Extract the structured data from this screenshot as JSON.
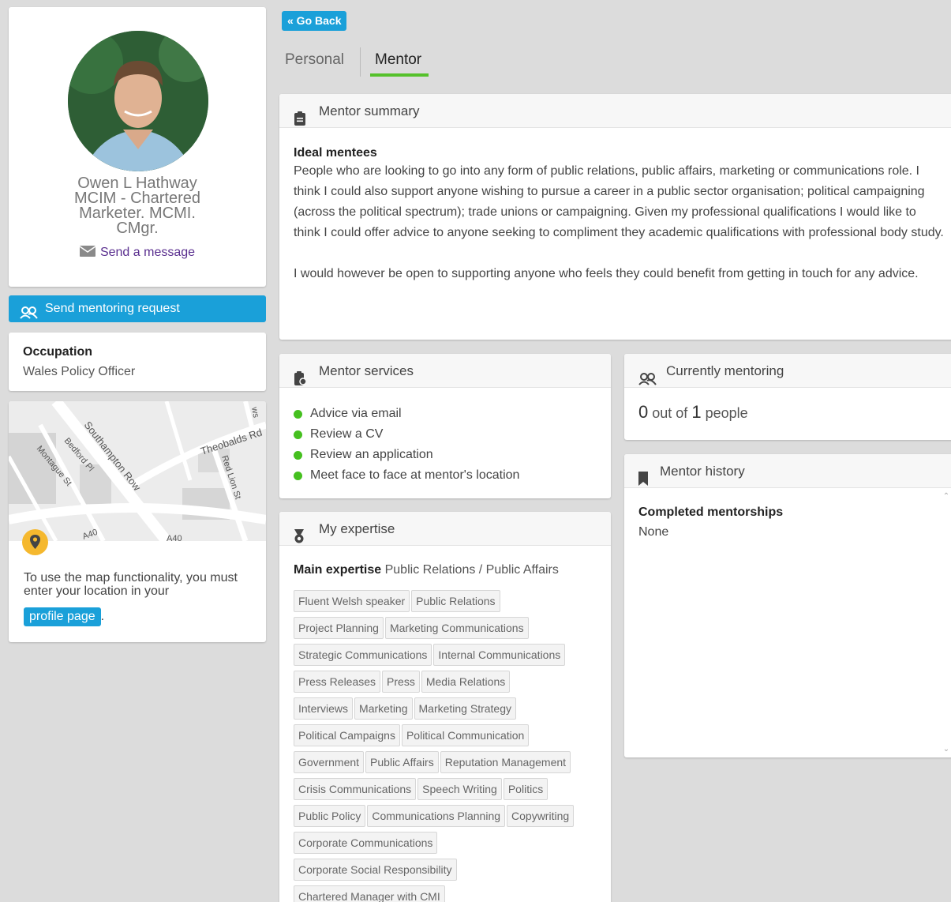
{
  "profile": {
    "name_line1": "Owen L Hathway",
    "name_line2": "MCIM - Chartered",
    "name_line3": "Marketer. MCMI.",
    "name_line4": "CMgr.",
    "send_message_label": "Send a message"
  },
  "mentoring_request_label": "Send mentoring request",
  "occupation": {
    "label": "Occupation",
    "value": "Wales Policy Officer"
  },
  "map": {
    "street_labels": [
      "Southampton Row",
      "Theobalds Rd",
      "Bedford Pl",
      "Montague St",
      "Red Lion St",
      "A40",
      "A40",
      "ws"
    ],
    "text": "To use the map functionality, you must enter your location in your",
    "link_label": "profile page",
    "suffix": "."
  },
  "nav": {
    "go_back_label": "« Go Back",
    "tabs": [
      {
        "label": "Personal",
        "active": false
      },
      {
        "label": "Mentor",
        "active": true
      }
    ]
  },
  "summary": {
    "title": "Mentor summary",
    "ideal_label": "Ideal mentees",
    "paragraph1": "People who are looking to go into any form of public relations, public affairs, marketing or communications role. I think I could also support anyone wishing to pursue a career in a public sector organisation; political campaigning (across the political spectrum); trade unions or campaigning. Given my professional qualifications I would like to think I could offer advice to anyone seeking to compliment they academic qualifications with professional body study.",
    "paragraph2": "I would however be open to supporting anyone who feels they could benefit from getting in touch for any advice."
  },
  "services": {
    "title": "Mentor services",
    "items": [
      "Advice via email",
      "Review a CV",
      "Review an application",
      "Meet face to face at mentor's location"
    ]
  },
  "expertise": {
    "title": "My expertise",
    "main_label": "Main expertise",
    "main_value": "Public Relations / Public Affairs",
    "tag_rows": [
      [
        "Fluent Welsh speaker",
        "Public Relations"
      ],
      [
        "Project Planning",
        "Marketing Communications"
      ],
      [
        "Strategic Communications",
        "Internal Communications"
      ],
      [
        "Press Releases",
        "Press",
        "Media Relations"
      ],
      [
        "Interviews",
        "Marketing",
        "Marketing Strategy"
      ],
      [
        "Political Campaigns",
        "Political Communication"
      ],
      [
        "Government",
        "Public Affairs",
        "Reputation Management"
      ],
      [
        "Crisis Communications",
        "Speech Writing",
        "Politics"
      ],
      [
        "Public Policy",
        "Communications Planning",
        "Copywriting"
      ],
      [
        "Corporate Communications"
      ],
      [
        "Corporate Social Responsibility"
      ],
      [
        "Chartered Manager with CMI"
      ]
    ]
  },
  "currently": {
    "title": "Currently mentoring",
    "count": "0",
    "out_of": "out of",
    "total": "1",
    "unit": "people"
  },
  "history": {
    "title": "Mentor history",
    "completed_label": "Completed mentorships",
    "completed_value": "None"
  },
  "colors": {
    "accent_blue": "#1aa0d9",
    "active_tab_green": "#55c12b",
    "service_dot_green": "#45c01f",
    "pin_yellow": "#f5b82e",
    "message_link_purple": "#5a2f8f"
  }
}
